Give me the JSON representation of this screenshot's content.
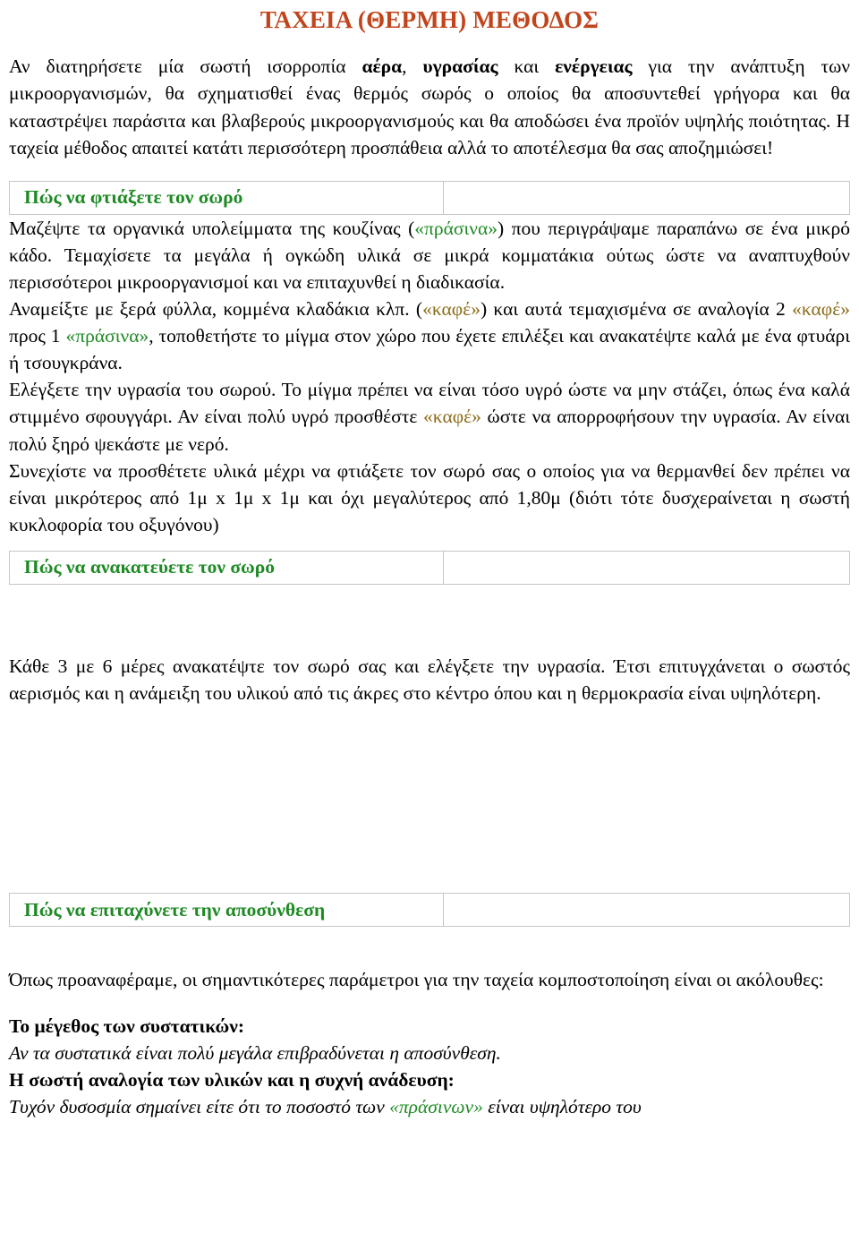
{
  "document": {
    "title": "ΤΑΧΕΙΑ (ΘΕΡΜΗ) ΜΕΘΟΔΟΣ",
    "title_color": "#C1451C",
    "heading_color": "#1E8A24",
    "green_inline_color": "#1E8A24",
    "brown_inline_color": "#8C6B18",
    "border_color": "#C6C6C6"
  },
  "intro": {
    "part1": "Αν διατηρήσετε μία σωστή ισορροπία ",
    "bold1": "αέρα",
    "part2": ", ",
    "bold2": "υγρασίας",
    "part3": " και ",
    "bold3": "ενέργειας",
    "part4": " για την ανάπτυξη των μικροοργανισμών, θα σχηματισθεί ένας θερμός σωρός ο οποίος θα αποσυντεθεί γρήγορα και θα καταστρέψει παράσιτα και βλαβερούς μικροοργανισμούς και θα αποδώσει ένα προϊόν υψηλής ποιότητας. Η ταχεία μέθοδος απαιτεί κατάτι περισσότερη προσπάθεια αλλά το αποτέλεσμα θα σας αποζημιώσει!"
  },
  "sections": [
    {
      "heading": "Πώς να φτιάξετε τον σωρό",
      "paragraphs": {
        "p1_a": "Μαζέψτε τα οργανικά υπολείμματα της κουζίνας (",
        "p1_green": "«πράσινα»",
        "p1_b": ") που περιγράψαμε παραπάνω σε ένα μικρό κάδο. Τεμαχίσετε τα μεγάλα ή ογκώδη υλικά σε μικρά κομματάκια ούτως ώστε να αναπτυχθούν περισσότεροι μικροοργανισμοί και να επιταχυνθεί η διαδικασία.",
        "p2_a": "Αναμείξτε με ξερά φύλλα, κομμένα κλαδάκια κλπ. (",
        "p2_brown1": "«καφέ»",
        "p2_b": ") και αυτά τεμαχισμένα σε αναλογία 2 ",
        "p2_brown2": "«καφέ»",
        "p2_c": " προς 1 ",
        "p2_green1": "«πράσινα»",
        "p2_d": ", τοποθετήστε το μίγμα στον χώρο που έχετε επιλέξει και ανακατέψτε καλά με ένα φτυάρι ή τσουγκράνα.",
        "p3_a": "Ελέγξετε την υγρασία του σωρού. Το μίγμα πρέπει να είναι τόσο υγρό ώστε να μην στάζει, όπως ένα καλά στιμμένο σφουγγάρι. Αν είναι πολύ υγρό προσθέστε ",
        "p3_brown": "«καφέ»",
        "p3_b": " ώστε να απορροφήσουν την υγρασία. Αν είναι πολύ ξηρό ψεκάστε με νερό.",
        "p4": "Συνεχίστε να προσθέτετε υλικά μέχρι να φτιάξετε τον σωρό σας ο οποίος για να θερμανθεί δεν πρέπει να είναι μικρότερος από 1μ x 1μ x 1μ και όχι μεγαλύτερος από 1,80μ (διότι τότε δυσχεραίνεται η σωστή κυκλοφορία του οξυγόνου)"
      }
    },
    {
      "heading": "Πώς να ανακατεύετε τον σωρό",
      "paragraphs": {
        "p1": "Κάθε 3 με 6 μέρες ανακατέψτε τον σωρό σας και ελέγξετε την υγρασία. Έτσι επιτυγχάνεται ο σωστός αερισμός και η ανάμειξη του υλικού από τις άκρες στο κέντρο όπου και η θερμοκρασία είναι υψηλότερη."
      }
    },
    {
      "heading": "Πώς να επιταχύνετε την αποσύνθεση",
      "paragraphs": {
        "p1": "Όπως προαναφέραμε, οι σημαντικότερες παράμετροι για την ταχεία κομποστοποίηση είναι οι ακόλουθες:"
      },
      "items": [
        {
          "title": "Το μέγεθος των συστατικών:",
          "text": "Αν τα συστατικά είναι πολύ μεγάλα επιβραδύνεται η αποσύνθεση."
        },
        {
          "title": "Η σωστή αναλογία των υλικών και η συχνή ανάδευση:",
          "text_a": "Τυχόν δυσοσμία σημαίνει είτε ότι το ποσοστό των ",
          "text_green": "«πράσινων»",
          "text_b": " είναι υψηλότερο του"
        }
      ]
    }
  ]
}
